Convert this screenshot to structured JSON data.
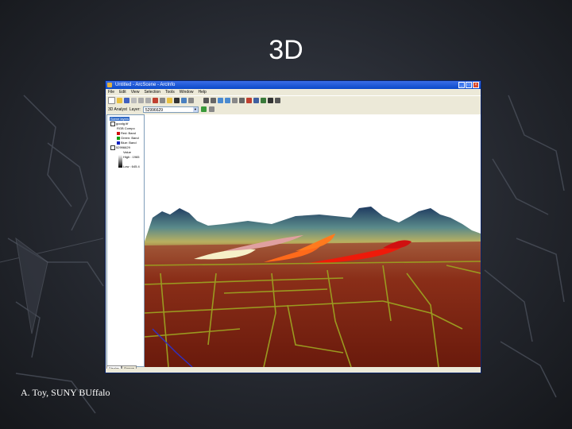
{
  "slide": {
    "title": "3D",
    "footer": "A. Toy, SUNY BUffalo"
  },
  "app": {
    "window_title": "Untitled - ArcScene - ArcInfo",
    "menus": [
      "File",
      "Edit",
      "View",
      "Selection",
      "Tools",
      "Window",
      "Help"
    ],
    "toolbar2": {
      "analyst_label": "3D Analyst",
      "layer_label": "Layer:",
      "layer_value": "52996629"
    },
    "toc": {
      "root": "Scene layers",
      "layer1": "goodg.tif",
      "layer1_sub": "RGB Compo",
      "bands": [
        {
          "color": "#d01010",
          "label": "Red: Band"
        },
        {
          "color": "#10a010",
          "label": "Green: Band"
        },
        {
          "color": "#1020c0",
          "label": "Blue: Band"
        }
      ],
      "layer2": "52996629",
      "value_label": "Value",
      "high": "High : 1965",
      "low": "Low : 645.4"
    },
    "tabs": [
      "Display",
      "Source"
    ]
  },
  "colors": {
    "titlebar": "#0a48c8",
    "terrain": "#8a2a12",
    "roads": "#9a9a20"
  }
}
